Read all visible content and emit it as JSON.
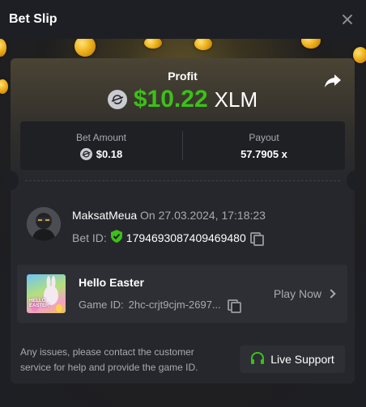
{
  "header": {
    "title": "Bet Slip"
  },
  "profit": {
    "label": "Profit",
    "amount": "$10.22",
    "currency": "XLM"
  },
  "stats": {
    "bet_amount_label": "Bet Amount",
    "bet_amount_value": "$0.18",
    "payout_label": "Payout",
    "payout_value": "57.7905 x"
  },
  "user": {
    "name": "MaksatMeua",
    "datetime": "On 27.03.2024, 17:18:23",
    "bet_id_label": "Bet ID:",
    "bet_id_value": "1794693087409469480"
  },
  "game": {
    "name": "Hello Easter",
    "thumb_text": "HELLO EASTER",
    "id_label": "Game ID:",
    "id_value": "2hc-crjt9cjm-2697...",
    "play_label": "Play Now"
  },
  "footer": {
    "issues_text": "Any issues, please contact the customer service for help and provide the game ID.",
    "support_label": "Live Support"
  },
  "colors": {
    "accent_green": "#3bc117",
    "background": "#1e1f24",
    "card": "#25272c"
  }
}
